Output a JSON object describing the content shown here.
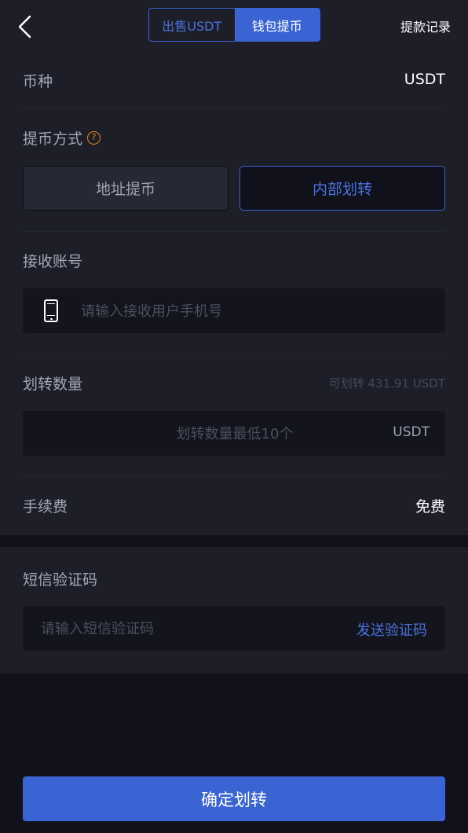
{
  "header": {
    "tabs": [
      {
        "label": "出售USDT",
        "active": false
      },
      {
        "label": "钱包提币",
        "active": true
      }
    ],
    "records_label": "提款记录"
  },
  "currency": {
    "label": "币种",
    "value": "USDT"
  },
  "method": {
    "label": "提币方式",
    "help_icon": "?",
    "options": [
      {
        "label": "地址提币",
        "selected": false
      },
      {
        "label": "内部划转",
        "selected": true
      }
    ]
  },
  "receiver": {
    "label": "接收账号",
    "icon": "phone-icon",
    "placeholder": "请输入接收用户手机号",
    "value": ""
  },
  "amount": {
    "label": "划转数量",
    "available": "可划转 431.91 USDT",
    "placeholder": "划转数量最低10个",
    "unit": "USDT",
    "value": ""
  },
  "fee": {
    "label": "手续费",
    "value": "免费"
  },
  "sms": {
    "label": "短信验证码",
    "placeholder": "请输入短信验证码",
    "send_label": "发送验证码",
    "value": ""
  },
  "submit_label": "确定划转",
  "colors": {
    "accent": "#3a63d4",
    "background": "#111219",
    "panel": "#1d1e28",
    "warning": "#e08a1e"
  }
}
